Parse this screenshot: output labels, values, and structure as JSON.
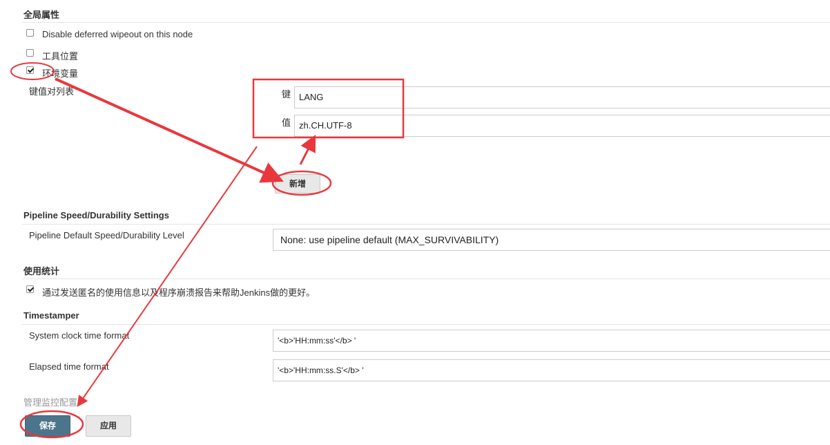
{
  "global_props": {
    "title": "全局属性",
    "disable_wipeout": "Disable deferred wipeout on this node",
    "tool_location": "工具位置",
    "env_vars": "环境变量",
    "kv_list": "键值对列表",
    "key_label": "键",
    "key_value": "LANG",
    "value_label": "值",
    "value_value": "zh.CH.UTF-8",
    "add_button": "新增"
  },
  "pipeline": {
    "title": "Pipeline Speed/Durability Settings",
    "level_label": "Pipeline Default Speed/Durability Level",
    "level_value": "None: use pipeline default (MAX_SURVIVABILITY)"
  },
  "usage": {
    "title": "使用统计",
    "report_label": "通过发送匿名的使用信息以及程序崩溃报告来帮助Jenkins做的更好。"
  },
  "timestamper": {
    "title": "Timestamper",
    "clock_label": "System clock time format",
    "clock_value": "'<b>'HH:mm:ss'</b> '",
    "elapsed_label": "Elapsed time format",
    "elapsed_value": "'<b>'HH:mm:ss.S'</b> '"
  },
  "monitor": {
    "title": "管理监控配置"
  },
  "footer": {
    "save": "保存",
    "apply": "应用"
  },
  "annotation_color": "#e8383d"
}
